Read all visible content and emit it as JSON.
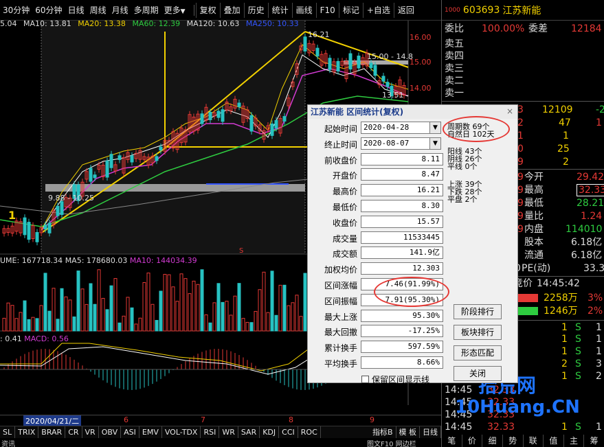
{
  "toolbar": {
    "periods": [
      "30分钟",
      "60分钟",
      "日线",
      "周线",
      "月线",
      "多周期",
      "更多"
    ],
    "buttons": [
      "复权",
      "叠加",
      "历史",
      "统计",
      "画线",
      "F10",
      "标记",
      "+自选",
      "返回"
    ]
  },
  "ma": {
    "ma5_val": "5.04",
    "ma10": "MA10: 13.81",
    "ma20": "MA20: 13.38",
    "ma60": "MA60: 12.39",
    "ma120": "MA120: 10.63",
    "ma250": "MA250: 10.33"
  },
  "price_axis": [
    "16.00",
    "15.00",
    "14.00"
  ],
  "annotations": {
    "high": "16.21",
    "range_top": "15.00 - 14.8",
    "mid": "13.51 -",
    "left_range": "9.88 - 10.25",
    "left_mark": "1",
    "s_mark": "S"
  },
  "volume": {
    "vol": "UME: 167718.34",
    "ma5": "MA5: 178680.03",
    "ma10": "MA10: 144034.39"
  },
  "macd": {
    "val": ": 0.41",
    "macd": "MACD: 0.56"
  },
  "dates": {
    "first": "2020/04/21/二",
    "d6": "6",
    "d7": "7",
    "d8": "8",
    "d9": "9"
  },
  "indicators": [
    "SL",
    "TRIX",
    "BRAR",
    "CR",
    "VR",
    "OBV",
    "ASI",
    "EMV",
    "VOL-TDX",
    "RSI",
    "WR",
    "SAR",
    "KDJ",
    "CCI",
    "ROC"
  ],
  "indicator_right": [
    "指标B",
    "模 板",
    "日线"
  ],
  "bottom": {
    "left": "资讯",
    "right": "图文F10  网边栏"
  },
  "stock": {
    "tag": "1000",
    "code": "603693",
    "name": "江苏新能"
  },
  "right_rows": [
    {
      "label": "委比",
      "v1": "100.00%",
      "v2": "委差",
      "v3": "12184"
    },
    {
      "label": "卖五"
    },
    {
      "label": "卖四"
    },
    {
      "label": "卖三"
    },
    {
      "label": "卖二"
    },
    {
      "label": "卖一"
    }
  ],
  "buy_rows": [
    {
      "a": "3",
      "b": "12109",
      "c": "-2"
    },
    {
      "a": "2",
      "b": "47",
      "c": "1"
    },
    {
      "a": "1",
      "b": "1",
      "c": ""
    },
    {
      "a": "0",
      "b": "25",
      "c": ""
    },
    {
      "a": "9",
      "b": "2",
      "c": ""
    }
  ],
  "quote_rows": [
    {
      "left": "9",
      "label": "今开",
      "val": "29.42"
    },
    {
      "left": "9",
      "label": "最高",
      "val": "32.33"
    },
    {
      "left": "9",
      "label": "最低",
      "val": "28.21"
    },
    {
      "left": "9",
      "label": "量比",
      "val": "1.24"
    },
    {
      "left": "9",
      "label": "内盘",
      "val": "114010"
    },
    {
      "left": "%",
      "label": "股本",
      "val": "6.18亿"
    },
    {
      "left": "万",
      "label": "流通",
      "val": "6.18亿"
    },
    {
      "left": "0",
      "label": "PE(动)",
      "val": "33.3"
    }
  ],
  "auction": {
    "label": "竞价",
    "time": "14:45:42"
  },
  "flow_rows": [
    {
      "v": "2258万",
      "p": "3%"
    },
    {
      "v": "1246万",
      "p": "2%"
    }
  ],
  "trade_rows": [
    {
      "n": "1",
      "s": "S",
      "c": "1"
    },
    {
      "n": "1",
      "s": "S",
      "c": "1"
    },
    {
      "n": "1",
      "s": "S",
      "c": "1"
    },
    {
      "n": "2",
      "s": "S",
      "c": "3"
    },
    {
      "n": "1",
      "s": "S",
      "c": "2"
    }
  ],
  "ticks": [
    {
      "t": "14:45",
      "p": "32.33",
      "n": "1",
      "s": "S",
      "c": "1"
    },
    {
      "t": "14:45",
      "p": "32.33",
      "n": "",
      "s": "",
      "c": ""
    },
    {
      "t": "14:45",
      "p": "32.33",
      "n": "",
      "s": "",
      "c": ""
    },
    {
      "t": "14:45",
      "p": "32.33",
      "n": "1",
      "s": "S",
      "c": "1"
    },
    {
      "t": "14:45",
      "p": "32.33",
      "n": "2",
      "s": "S",
      "c": "1"
    }
  ],
  "side_tabs": [
    "笔",
    "价",
    "细",
    "势",
    "联",
    "值",
    "主",
    "筹"
  ],
  "dialog": {
    "title": "江苏新能 区间统计(复权)",
    "close": "×",
    "labels": [
      "起始时间",
      "终止时间",
      "前收盘价",
      "开盘价",
      "最高价",
      "最低价",
      "收盘价",
      "成交量",
      "成交额",
      "加权均价",
      "区间涨幅",
      "区间振幅",
      "最大上涨",
      "最大回撤",
      "累计换手",
      "平均换手"
    ],
    "values": [
      "2020-04-28",
      "2020-08-07",
      "8.11",
      "8.47",
      "16.21",
      "8.30",
      "15.57",
      "11533445",
      "141.9亿",
      "12.303",
      "7.46(91.99%)",
      "7.91(95.30%)",
      "95.30%",
      "-17.25%",
      "597.59%",
      "8.66%"
    ],
    "stats": {
      "period": "周期数 69个",
      "natural": "自然日 102天",
      "yang": "阳线 43个",
      "yin": "阴线 26个",
      "flat": "平线 0个",
      "up": "上涨 39个",
      "down": "下跌 28个",
      "same": "平盘 2个"
    },
    "buttons": [
      "阶段排行",
      "板块排行",
      "形态匹配",
      "关闭"
    ],
    "checkbox": "保留区间显示线"
  },
  "watermark": {
    "line1": "拾荒网",
    "line2": "10Huang.CN"
  },
  "colors": {
    "up": "#e53935",
    "down": "#27c2c2",
    "ma_yellow": "#f2d100",
    "ma_magenta": "#d23bd2",
    "ma_green": "#2ecc40",
    "ma_white": "#ffffff"
  }
}
